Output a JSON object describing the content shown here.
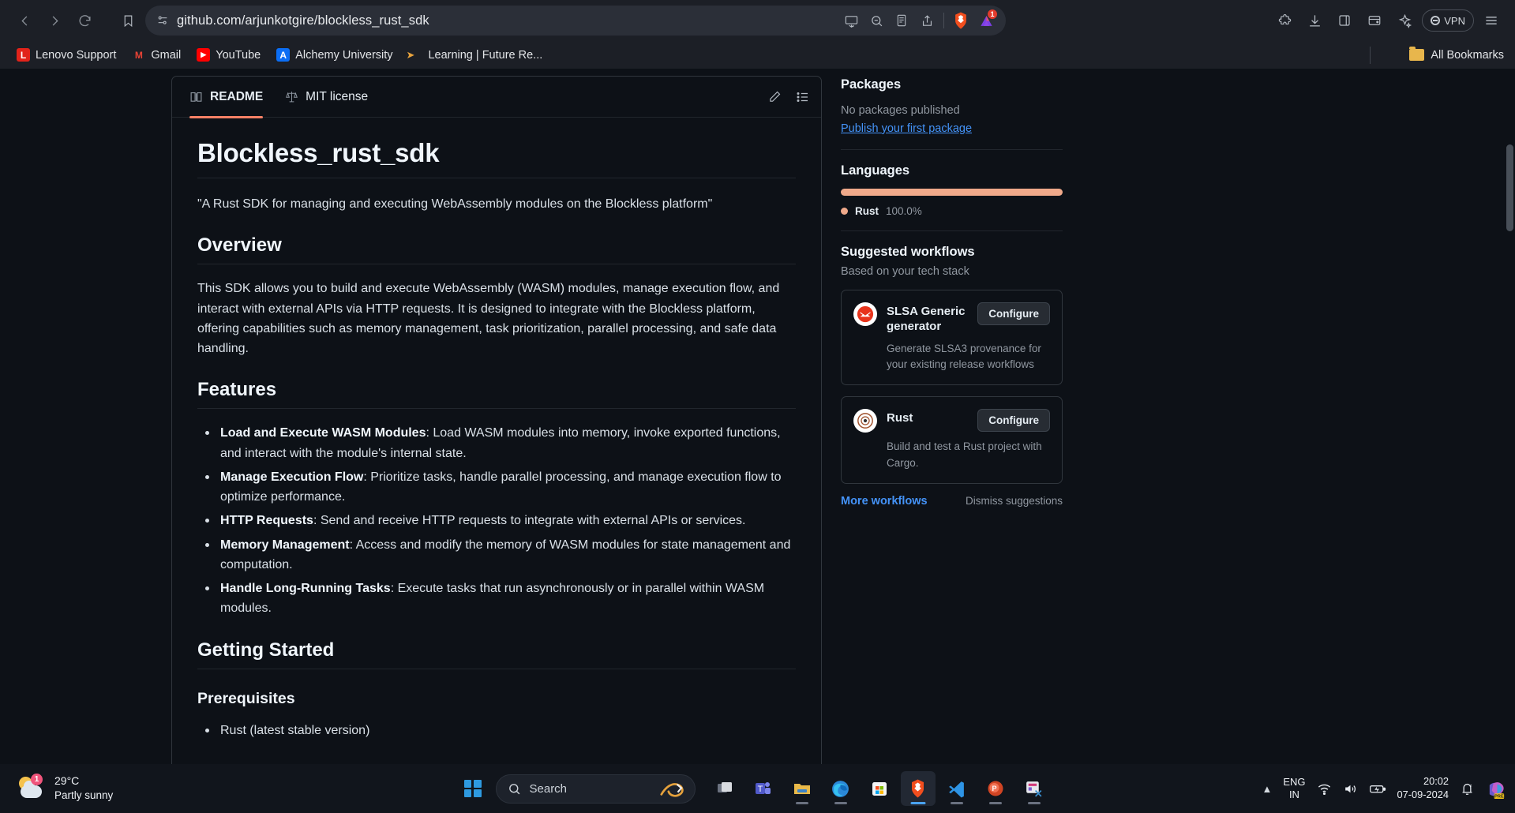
{
  "browser": {
    "url": "github.com/arjunkotgire/blockless_rust_sdk",
    "back_label": "Back",
    "forward_label": "Forward",
    "reload_label": "Reload",
    "shields_badge": "1",
    "vpn_label": "VPN",
    "all_bookmarks_label": "All Bookmarks",
    "bookmarks": [
      {
        "label": "Lenovo Support",
        "letter": "L",
        "color": "#e2231a"
      },
      {
        "label": "Gmail",
        "letter": "M",
        "color": "#ffffff"
      },
      {
        "label": "YouTube",
        "letter": "▶",
        "color": "#ff0000"
      },
      {
        "label": "Alchemy University",
        "letter": "A",
        "color": "#0b6ef5"
      },
      {
        "label": "Learning | Future Re...",
        "letter": "",
        "color": "#e8a33d"
      }
    ]
  },
  "readme": {
    "tabs": [
      {
        "label": "README",
        "icon": "book-icon",
        "active": true
      },
      {
        "label": "MIT license",
        "icon": "scale-icon",
        "active": false
      }
    ],
    "edit_label": "Edit",
    "outline_label": "Outline",
    "title": "Blockless_rust_sdk",
    "tagline": "\"A Rust SDK for managing and executing WebAssembly modules on the Blockless platform\"",
    "overview_heading": "Overview",
    "overview_text": "This SDK allows you to build and execute WebAssembly (WASM) modules, manage execution flow, and interact with external APIs via HTTP requests. It is designed to integrate with the Blockless platform, offering capabilities such as memory management, task prioritization, parallel processing, and safe data handling.",
    "features_heading": "Features",
    "features": [
      {
        "term": "Load and Execute WASM Modules",
        "desc": ": Load WASM modules into memory, invoke exported functions, and interact with the module's internal state."
      },
      {
        "term": "Manage Execution Flow",
        "desc": ": Prioritize tasks, handle parallel processing, and manage execution flow to optimize performance."
      },
      {
        "term": "HTTP Requests",
        "desc": ": Send and receive HTTP requests to integrate with external APIs or services."
      },
      {
        "term": "Memory Management",
        "desc": ": Access and modify the memory of WASM modules for state management and computation."
      },
      {
        "term": "Handle Long-Running Tasks",
        "desc": ": Execute tasks that run asynchronously or in parallel within WASM modules."
      }
    ],
    "getting_started_heading": "Getting Started",
    "prerequisites_heading": "Prerequisites",
    "prerequisites": [
      {
        "term": "",
        "desc": "Rust (latest stable version)"
      }
    ]
  },
  "sidebar": {
    "packages": {
      "title": "Packages",
      "empty_text": "No packages published",
      "link_label": "Publish your first package"
    },
    "languages": {
      "title": "Languages",
      "bar_color": "#efa98a",
      "items": [
        {
          "name": "Rust",
          "percent": "100.0%",
          "color": "#efa98a"
        }
      ]
    },
    "workflows": {
      "title": "Suggested workflows",
      "subtitle": "Based on your tech stack",
      "cards": [
        {
          "name": "SLSA Generic generator",
          "desc": "Generate SLSA3 provenance for your existing release workflows",
          "button": "Configure",
          "logo": "slsa-icon"
        },
        {
          "name": "Rust",
          "desc": "Build and test a Rust project with Cargo.",
          "button": "Configure",
          "logo": "rust-icon"
        }
      ],
      "more_label": "More workflows",
      "dismiss_label": "Dismiss suggestions"
    }
  },
  "taskbar": {
    "weather": {
      "temp": "29°C",
      "condition": "Partly sunny",
      "badge": "1"
    },
    "search_placeholder": "Search",
    "start_label": "Start",
    "apps": [
      {
        "name": "task-view",
        "label": "Task View"
      },
      {
        "name": "microsoft-teams",
        "label": "Microsoft Teams"
      },
      {
        "name": "file-explorer",
        "label": "File Explorer"
      },
      {
        "name": "microsoft-edge",
        "label": "Microsoft Edge"
      },
      {
        "name": "microsoft-store",
        "label": "Microsoft Store"
      },
      {
        "name": "brave-browser",
        "label": "Brave"
      },
      {
        "name": "visual-studio-code",
        "label": "Visual Studio Code"
      },
      {
        "name": "powerpoint",
        "label": "PowerPoint"
      },
      {
        "name": "snipping-tool",
        "label": "Snipping Tool"
      }
    ],
    "language": {
      "line1": "ENG",
      "line2": "IN"
    },
    "clock": {
      "time": "20:02",
      "date": "07-09-2024"
    }
  }
}
